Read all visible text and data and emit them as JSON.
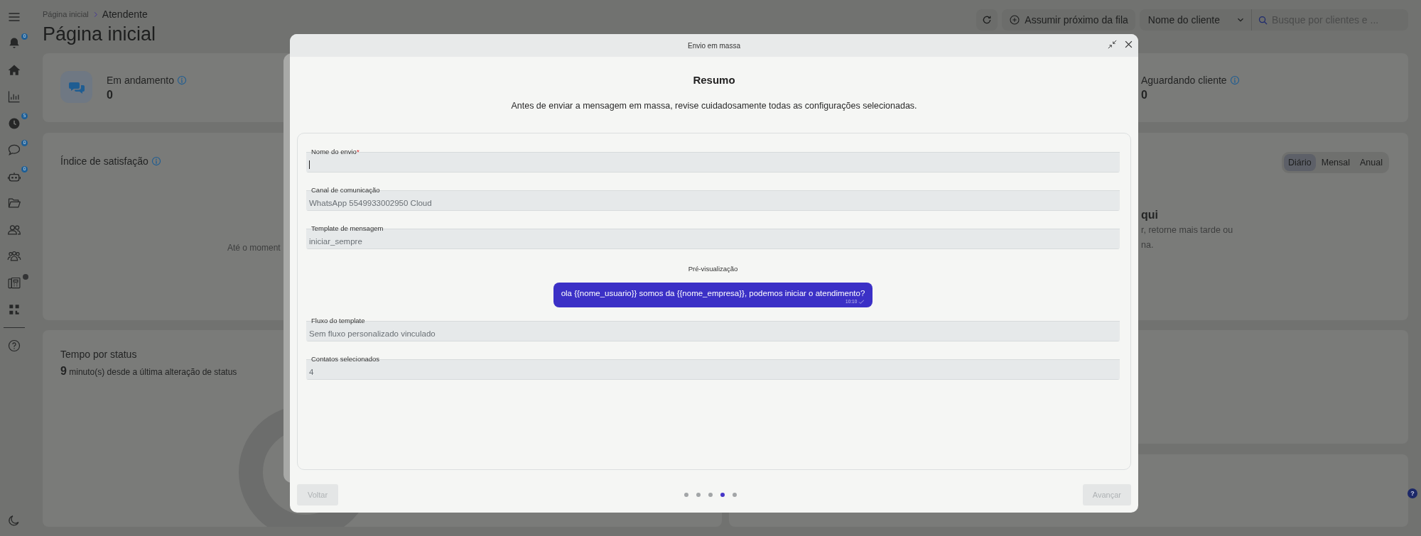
{
  "sidebar": {
    "items": [
      {
        "kind": "menu",
        "status_dot": false
      },
      {
        "kind": "bell",
        "badge": "0",
        "status_dot": false
      },
      {
        "kind": "home",
        "status_dot": false
      },
      {
        "kind": "chart",
        "status_dot": false
      },
      {
        "kind": "clock",
        "badge": "5",
        "status_dot": false
      },
      {
        "kind": "chat",
        "badge": "0",
        "status_dot": false
      },
      {
        "kind": "robot",
        "badge": "0",
        "status_dot": false
      },
      {
        "kind": "folder",
        "status_dot": false
      },
      {
        "kind": "people",
        "status_dot": false
      },
      {
        "kind": "team",
        "status_dot": false
      },
      {
        "kind": "phone",
        "status_dot": true
      },
      {
        "kind": "apps",
        "status_dot": false
      }
    ],
    "footer_items": [
      {
        "kind": "help"
      }
    ],
    "theme_toggle": {
      "kind": "moon"
    }
  },
  "breadcrumb": [
    "Página inicial",
    "Atendente"
  ],
  "page_title": "Página inicial",
  "toolbar": {
    "queue_button": "Assumir próximo da fila",
    "client_filter": "Nome do cliente",
    "search_placeholder": "Busque por clientes e ..."
  },
  "stats": [
    {
      "label": "Em andamento",
      "value": "0",
      "has_icon": true
    },
    {
      "label": "Aguardando cliente",
      "value": "0",
      "has_icon": false
    }
  ],
  "satisfaction": {
    "title": "Índice de satisfação",
    "empty_text": "Até o moment"
  },
  "period_card": {
    "tabs": [
      {
        "label": "Diário",
        "selected": true
      },
      {
        "label": "Mensal",
        "selected": false
      },
      {
        "label": "Anual",
        "selected": false
      }
    ],
    "empty_title": "qui",
    "empty_lines": [
      "r, retorne mais tarde ou",
      "na."
    ]
  },
  "status_time": {
    "title": "Tempo por status",
    "text": "**9** minuto(s) desde a última alteração de status"
  },
  "help_button": "?",
  "modal": {
    "title": "Envio em massa",
    "heading": "Resumo",
    "description": "Antes de enviar a mensagem em massa, revise cuidadosamente todas as configurações selecionadas.",
    "fields": [
      {
        "kind": "field",
        "label": "Nome do envio",
        "required_mark": "*",
        "focused": true
      },
      {
        "kind": "field",
        "label": "Canal de comunicação",
        "value": "WhatsApp 5549933002950 Cloud",
        "focused": false
      },
      {
        "kind": "field",
        "label": "Template de mensagem",
        "value": "iniciar_sempre",
        "focused": false
      },
      {
        "kind": "preview",
        "label": "Pré-visualização",
        "message": "ola {{nome_usuario}} somos da {{nome_empresa}}, podemos iniciar o atendimento?",
        "time": "10:10"
      },
      {
        "kind": "field",
        "label": "Fluxo do template",
        "value": "Sem fluxo personalizado vinculado",
        "focused": false
      },
      {
        "kind": "field",
        "label": "Contatos selecionados",
        "value": "4",
        "focused": false
      }
    ],
    "steps": [
      {
        "selected": false
      },
      {
        "selected": false
      },
      {
        "selected": false
      },
      {
        "selected": true
      },
      {
        "selected": false
      }
    ],
    "back_button": {
      "label": "Voltar",
      "disabled": true
    },
    "next_button": {
      "label": "Avançar",
      "disabled": true
    }
  }
}
